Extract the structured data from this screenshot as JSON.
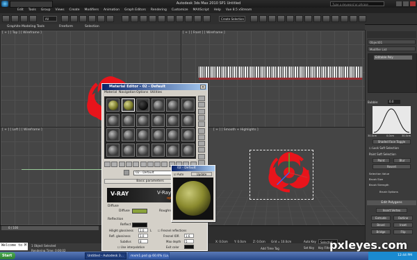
{
  "app": {
    "window_title": "Autodesk 3ds Max 2010 SP1",
    "document": "Untitled",
    "search_placeholder": "Type a keyword or phrase"
  },
  "menu": [
    "Edit",
    "Tools",
    "Group",
    "Views",
    "Create",
    "Modifiers",
    "Animation",
    "Graph Editors",
    "Rendering",
    "Customize",
    "MAXScript",
    "Help",
    "Vue 8.5 xStream"
  ],
  "toolbar": {
    "selection_filter": "All",
    "named_selection": "Create Selection"
  },
  "ribbon": {
    "tabs": [
      "Graphite Modeling Tools",
      "Freeform",
      "Selection"
    ]
  },
  "viewports": {
    "top": "[ + ] [ Top ] [ Wireframe ]",
    "front": "[ + ] [ Front ] [ Wireframe ]",
    "left": "[ + ] [ Left ] [ Wireframe ]",
    "persp": "[ + ] [ Smooth + Highlights ]"
  },
  "command_panel": {
    "object_name": "Object01",
    "modifier_list": "Modifier List",
    "stack_item": "Editable Poly",
    "bubble_label": "Bubble:",
    "bubble_value": "0.0",
    "falloff_min": "30.0cm",
    "falloff_mid": "0.0cm",
    "falloff_max": "30.0cm",
    "shaded_face_toggle": "Shaded Face Toggle",
    "lock_soft": "Lock Soft Selection",
    "paint_soft": "Paint Soft Selection",
    "paint": "Paint",
    "blur": "Blur",
    "revert": "Revert",
    "selection_value": "Selection Value",
    "brush_size": "Brush Size",
    "brush_strength": "Brush Strength",
    "brush_options": "Brush Options",
    "edit_polygons": "Edit Polygons",
    "insert_vertex": "Insert Vertex",
    "extrude": "Extrude",
    "outline": "Outline",
    "bevel": "Bevel",
    "inset": "Inset",
    "bridge": "Bridge",
    "flip": "Flip"
  },
  "material_editor": {
    "title": "Material Editor - 02 - Default",
    "menu": [
      "Material",
      "Navigation",
      "Options",
      "Utilities"
    ],
    "material_name": "02 - Default",
    "type_badge": "VRayMtl",
    "rollout": "Basic parameters",
    "vray_logo": "V-RAY",
    "vray_subtitle": "V-Ray P...",
    "vray_optim": "optim...",
    "diffuse_group": "Diffuse",
    "diffuse": "Diffuse",
    "roughness": "Roughn...",
    "reflection_group": "Reflection",
    "reflect": "Reflect",
    "hilight_gloss": "Hilight glossiness",
    "hilight_gloss_val": "1.0",
    "refl_gloss": "Refl. glossiness",
    "refl_gloss_val": "1.0",
    "subdivs": "Subdivs",
    "subdivs_val": "8",
    "use_interp": "Use interpolation",
    "fresnel": "Fresnel reflections",
    "fresnel_ior": "Fresnel IOR",
    "fresnel_ior_val": "1.6",
    "max_depth": "Max depth",
    "max_depth_val": "5",
    "exit_color": "Exit color",
    "L": "L"
  },
  "preview_window": {
    "title": "02 - Default",
    "auto": "Auto",
    "update": "Update"
  },
  "status": {
    "timeline": "0 / 100",
    "objects_selected": "1 Object Selected",
    "render_time": "Rendering Time: 0:00:02",
    "x": "X: 0.0cm",
    "y": "Y: 0.0cm",
    "z": "Z: 0.0cm",
    "grid": "Grid = 10.0cm",
    "auto_key": "Auto Key",
    "selected": "Selected",
    "set_key": "Set Key",
    "key_filters": "Key Filters...",
    "add_time_tag": "Add Time Tag",
    "maxscript": "Welcome to M"
  },
  "taskbar": {
    "start": "Start",
    "task1": "Untitled - Autodesk 3...",
    "task2": "mxm1.psd @ 60.6% (La...",
    "clock": "12:44 PM"
  },
  "watermark": "pxleyes.com",
  "colors": {
    "accent": "#e8141b",
    "vray_green": "#8aa23a",
    "title_blue": "#0a246a"
  }
}
